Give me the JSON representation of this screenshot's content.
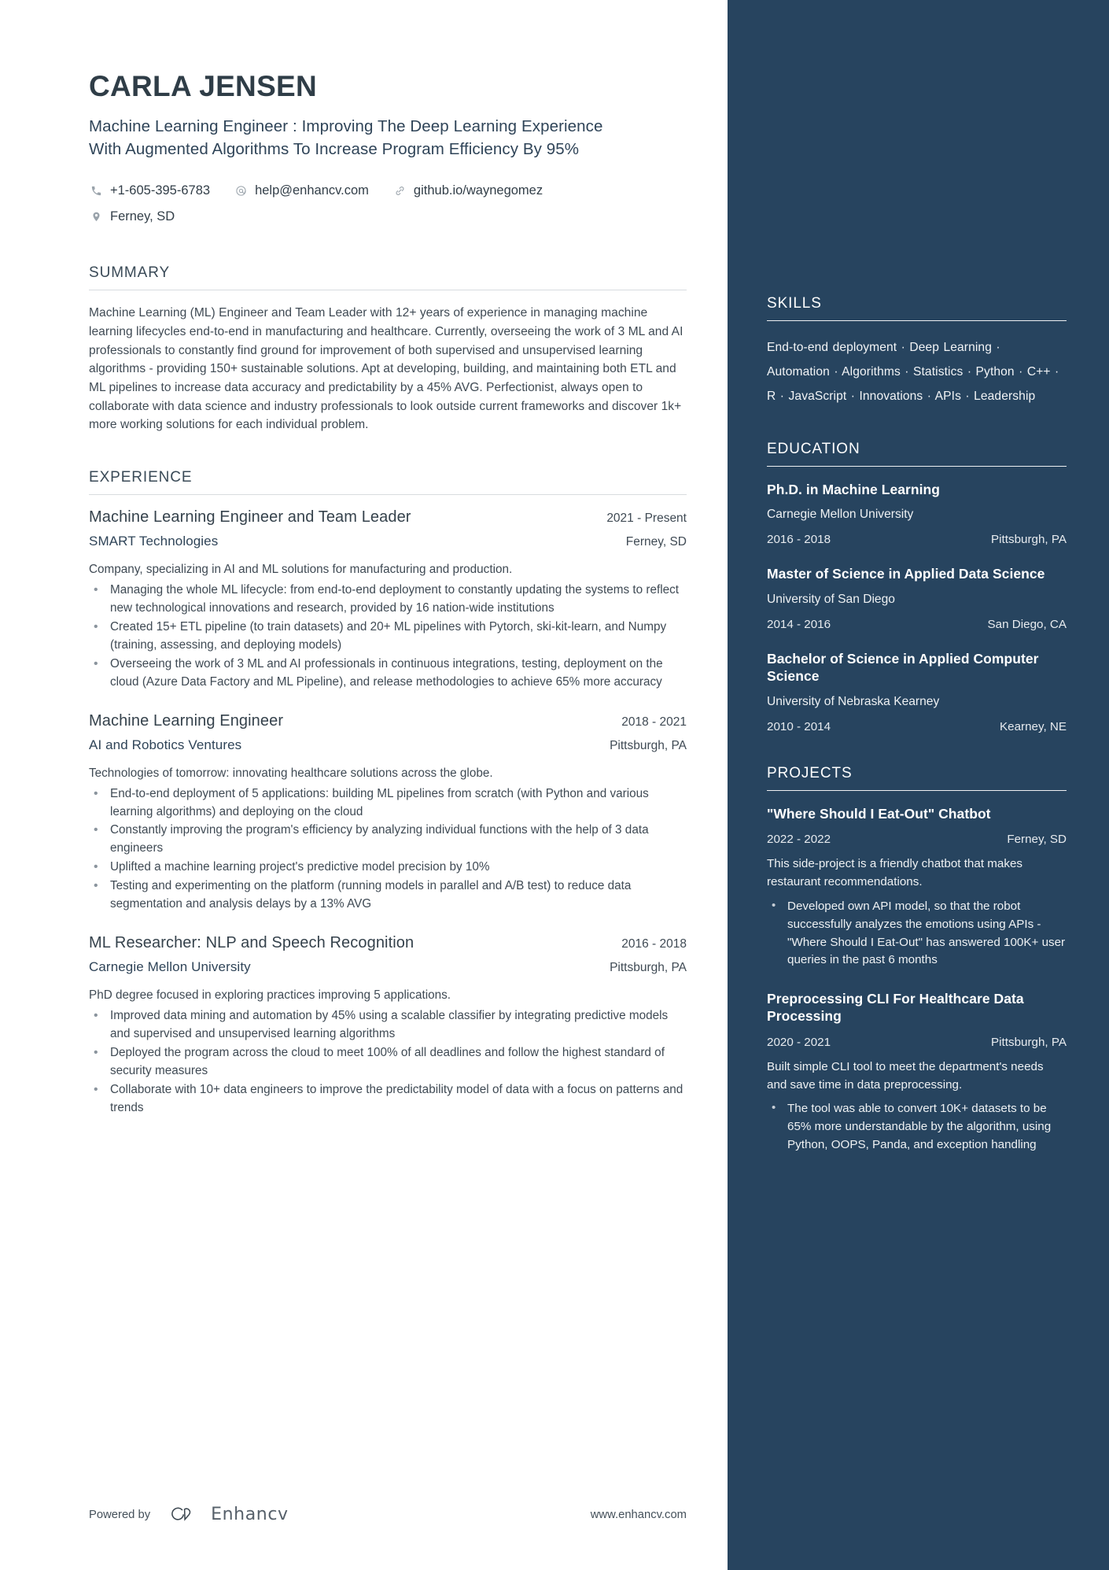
{
  "header": {
    "name": "CARLA JENSEN",
    "headline": "Machine Learning Engineer : Improving The Deep Learning Experience With Augmented Algorithms To Increase Program Efficiency By 95%",
    "contacts": [
      {
        "icon": "phone-icon",
        "text": "+1-605-395-6783"
      },
      {
        "icon": "email-icon",
        "text": "help@enhancv.com"
      },
      {
        "icon": "link-icon",
        "text": "github.io/waynegomez"
      },
      {
        "icon": "location-icon",
        "text": "Ferney, SD"
      }
    ]
  },
  "summary": {
    "title": "SUMMARY",
    "text": "Machine Learning (ML) Engineer and Team Leader with 12+ years of experience in managing machine learning lifecycles end-to-end in manufacturing and healthcare. Currently, overseeing the work of 3 ML and AI professionals to constantly find ground for improvement of both supervised and unsupervised learning algorithms - providing 150+ sustainable solutions. Apt at developing, building, and maintaining both ETL and ML pipelines to increase data accuracy and predictability by a 45% AVG. Perfectionist, always open to collaborate with data science and industry professionals to look outside current frameworks and discover 1k+ more working solutions for each individual problem."
  },
  "experience": {
    "title": "EXPERIENCE",
    "jobs": [
      {
        "title": "Machine Learning Engineer and Team Leader",
        "date": "2021 - Present",
        "company": "SMART Technologies",
        "location": "Ferney, SD",
        "description": "Company, specializing in AI and ML solutions for manufacturing and production.",
        "bullets": [
          "Managing the whole ML lifecycle: from end-to-end deployment to constantly updating the systems to reflect new technological innovations and research, provided by 16 nation-wide institutions",
          "Created 15+ ETL pipeline (to train datasets) and 20+ ML pipelines with Pytorch, ski-kit-learn, and Numpy (training, assessing, and deploying models)",
          "Overseeing the work of 3 ML and AI professionals in continuous integrations, testing, deployment on the cloud (Azure Data Factory and ML Pipeline), and release methodologies to achieve 65% more accuracy"
        ]
      },
      {
        "title": "Machine Learning Engineer",
        "date": "2018 - 2021",
        "company": "AI and Robotics Ventures",
        "location": "Pittsburgh, PA",
        "description": "Technologies of tomorrow: innovating healthcare solutions across the globe.",
        "bullets": [
          "End-to-end deployment of 5 applications: building ML pipelines from scratch (with Python and various learning algorithms) and deploying on the cloud",
          "Constantly improving the program's efficiency by analyzing individual functions with the help of 3 data engineers",
          "Uplifted a machine learning project's predictive model precision by 10%",
          "Testing and experimenting on the platform (running models in parallel and A/B test) to reduce data segmentation and analysis delays by a 13% AVG"
        ]
      },
      {
        "title": "ML Researcher: NLP and Speech Recognition",
        "date": "2016 - 2018",
        "company": "Carnegie Mellon University",
        "location": "Pittsburgh, PA",
        "description": "PhD degree focused in exploring practices improving 5 applications.",
        "bullets": [
          "Improved data mining and automation by 45% using a scalable classifier by integrating predictive models and supervised and unsupervised learning algorithms",
          "Deployed the program across the cloud to meet 100% of all deadlines and follow the highest standard of security measures",
          "Collaborate with 10+ data engineers to improve the predictability model of data with a focus on patterns and trends"
        ]
      }
    ]
  },
  "skills": {
    "title": "SKILLS",
    "text": "End-to-end deployment · Deep Learning · Automation · Algorithms · Statistics · Python · C++ · R  · JavaScript · Innovations · APIs · Leadership"
  },
  "education": {
    "title": "EDUCATION",
    "items": [
      {
        "degree": "Ph.D. in Machine Learning",
        "school": "Carnegie Mellon University",
        "date": "2016 - 2018",
        "location": "Pittsburgh, PA"
      },
      {
        "degree": "Master of Science in Applied Data Science",
        "school": "University of San Diego",
        "date": "2014 - 2016",
        "location": "San Diego, CA"
      },
      {
        "degree": "Bachelor of Science in Applied Computer Science",
        "school": "University of Nebraska Kearney",
        "date": "2010 - 2014",
        "location": "Kearney, NE"
      }
    ]
  },
  "projects": {
    "title": "PROJECTS",
    "items": [
      {
        "name": "\"Where Should I Eat-Out\" Chatbot",
        "date": "2022 - 2022",
        "location": "Ferney, SD",
        "description": "This side-project is a friendly chatbot that makes restaurant recommendations.",
        "bullets": [
          "Developed own API model, so that the robot successfully analyzes the emotions using APIs - \"Where Should I Eat-Out\" has answered 100K+ user queries in the past 6 months"
        ]
      },
      {
        "name": "Preprocessing CLI For Healthcare Data Processing",
        "date": "2020 - 2021",
        "location": "Pittsburgh, PA",
        "description": "Built simple CLI tool to meet the department's needs and save time in data preprocessing.",
        "bullets": [
          "The tool was able to convert 10K+ datasets to be 65% more understandable by the algorithm, using Python, OOPS, Panda, and exception handling"
        ]
      }
    ]
  },
  "footer": {
    "powered_by": "Powered by",
    "brand": "Enhancv",
    "url": "www.enhancv.com"
  },
  "colors": {
    "sidebar_bg": "#27445f",
    "accent_text": "#2f4458",
    "body_text": "#3f4a54"
  }
}
